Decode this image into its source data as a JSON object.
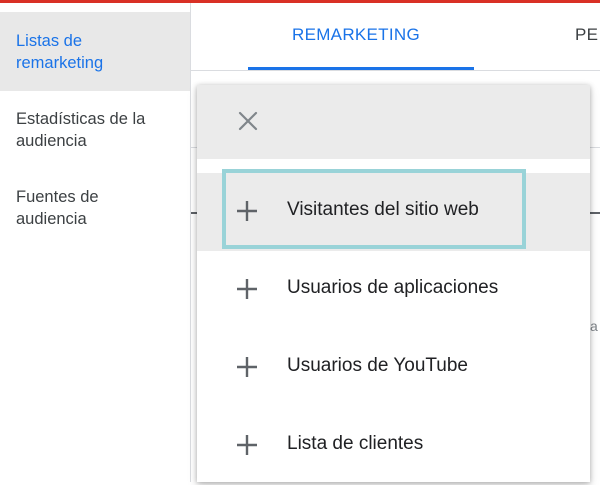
{
  "sidebar": {
    "items": [
      {
        "label": "Listas de\nremarketing",
        "active": true
      },
      {
        "label": "Estadísticas de la\naudiencia",
        "active": false
      },
      {
        "label": "Fuentes de\naudiencia",
        "active": false
      }
    ]
  },
  "tabs": [
    {
      "label": "REMARKETING",
      "active": true
    },
    {
      "label": "PE",
      "active": false
    }
  ],
  "background": {
    "partial_text": "a"
  },
  "menu": {
    "close_icon": "close-icon",
    "items": [
      {
        "label": "Visitantes del sitio web",
        "icon": "plus-icon",
        "highlighted": true
      },
      {
        "label": "Usuarios de aplicaciones",
        "icon": "plus-icon",
        "highlighted": false
      },
      {
        "label": "Usuarios de YouTube",
        "icon": "plus-icon",
        "highlighted": false
      },
      {
        "label": "Lista de clientes",
        "icon": "plus-icon",
        "highlighted": false
      }
    ]
  },
  "colors": {
    "accent": "#1a73e8",
    "top_bar": "#d93025",
    "highlight_border": "#99d3d8",
    "icon_gray": "#5f6368"
  }
}
